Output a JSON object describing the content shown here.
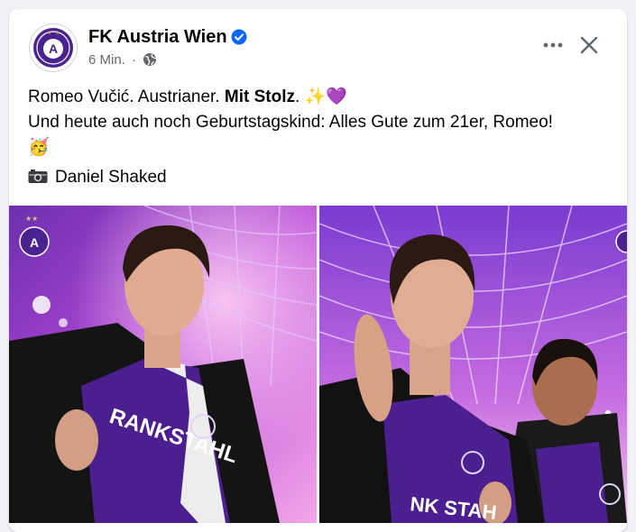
{
  "post": {
    "page_name": "FK Austria Wien",
    "timestamp": "6 Min.",
    "separator": "·",
    "line1_prefix": "Romeo Vučić. Austrianer. ",
    "line1_bold": "Mit Stolz",
    "line1_suffix": ".",
    "line1_emoji": "✨💜",
    "line2": "Und heute auch noch Geburtstagskind: Alles Gute zum 21er, Romeo!",
    "line2_emoji": "🥳",
    "credit": "Daniel Shaked"
  },
  "photos": [
    {
      "name": "photo-1",
      "jersey_text": "RANKSTAHL"
    },
    {
      "name": "photo-2",
      "jersey_text": "NK STAH"
    }
  ],
  "icons": {
    "verified": "verified-badge-icon",
    "globe": "globe-icon",
    "more": "more-options-icon",
    "close": "close-icon",
    "camera": "camera-icon"
  },
  "colors": {
    "verified_blue": "#0866ff",
    "club_violet": "#5b2a9c",
    "secondary_text": "#65676b"
  }
}
